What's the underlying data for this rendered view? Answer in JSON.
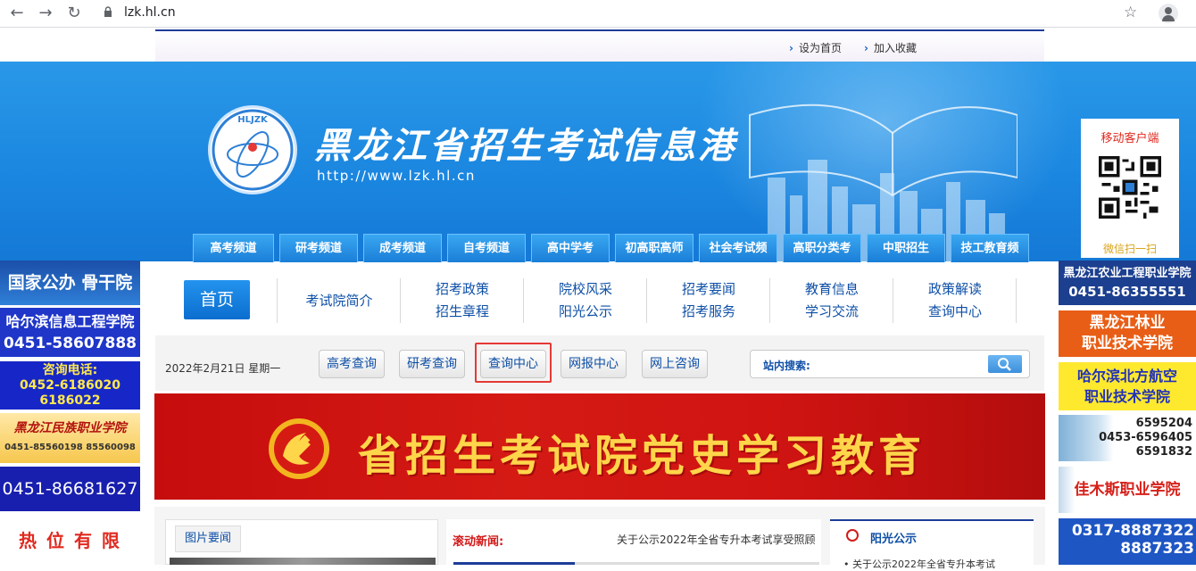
{
  "browser": {
    "url": "lzk.hl.cn"
  },
  "top_links": {
    "set_home": "设为首页",
    "add_favorite": "加入收藏"
  },
  "banner": {
    "logo_text": "HLJZK",
    "title": "黑龙江省招生考试信息港",
    "url": "http://www.lzk.hl.cn"
  },
  "channel_tabs": [
    "高考频道",
    "研考频道",
    "成考频道",
    "自考频道",
    "高中学考",
    "初高职高师",
    "社会考试频道",
    "高职分类考试",
    "中职招生",
    "技工教育频道"
  ],
  "qr_panel": {
    "title": "移动客户端",
    "caption": "微信扫一扫"
  },
  "main_nav": {
    "home": "首页",
    "columns": [
      {
        "top": "考试院简介",
        "bottom": ""
      },
      {
        "top": "招考政策",
        "bottom": "招生章程"
      },
      {
        "top": "院校风采",
        "bottom": "阳光公示"
      },
      {
        "top": "招考要闻",
        "bottom": "招考服务"
      },
      {
        "top": "教育信息",
        "bottom": "学习交流"
      },
      {
        "top": "政策解读",
        "bottom": "查询中心"
      }
    ]
  },
  "query_bar": {
    "date": "2022年2月21日 星期一",
    "buttons": [
      "高考查询",
      "研考查询",
      "查询中心",
      "网报中心",
      "网上咨询"
    ],
    "search_label": "站内搜索:",
    "search_value": ""
  },
  "party_banner": {
    "text": "省招生考试院党史学习教育"
  },
  "content": {
    "pic_tab": "图片要闻",
    "news_label": "滚动新闻:",
    "news_item": "关于公示2022年全省专升本考试享受照顾",
    "sun_title": "阳光公示",
    "sun_item": "• 关于公示2022年全省专升本考试"
  },
  "left_ads": [
    {
      "lines": [
        "国家公办 骨干院校"
      ]
    },
    {
      "lines": [
        "哈尔滨信息工程学院",
        "0451-58607888"
      ]
    },
    {
      "lines": [
        "咨询电话:",
        "0452-6186020",
        "6186022"
      ]
    },
    {
      "lines": [
        "黑龙江民族职业学院",
        "0451-85560198   85560098"
      ]
    },
    {
      "lines": [
        "0451-86681627"
      ]
    },
    {
      "lines": [
        "热 位 有 限"
      ]
    }
  ],
  "right_ads": [
    {
      "lines": [
        "黑龙江农业工程职业学院",
        "0451-86355551"
      ]
    },
    {
      "lines": [
        "黑龙江林业",
        "职业技术学院"
      ]
    },
    {
      "lines": [
        "哈尔滨北方航空",
        "职业技术学院"
      ]
    },
    {
      "lines": [
        "6595204",
        "0453-6596405",
        "6591832"
      ]
    },
    {
      "lines": [
        "佳木斯职业学院"
      ]
    },
    {
      "lines": [
        "0317-8887322",
        "8887323"
      ]
    }
  ],
  "colors": {
    "banner_blue": "#1b87e0",
    "nav_text": "#0e4fa6",
    "party_red": "#d51a14",
    "party_gold": "#ffd54a",
    "highlight_red": "#e53935"
  }
}
